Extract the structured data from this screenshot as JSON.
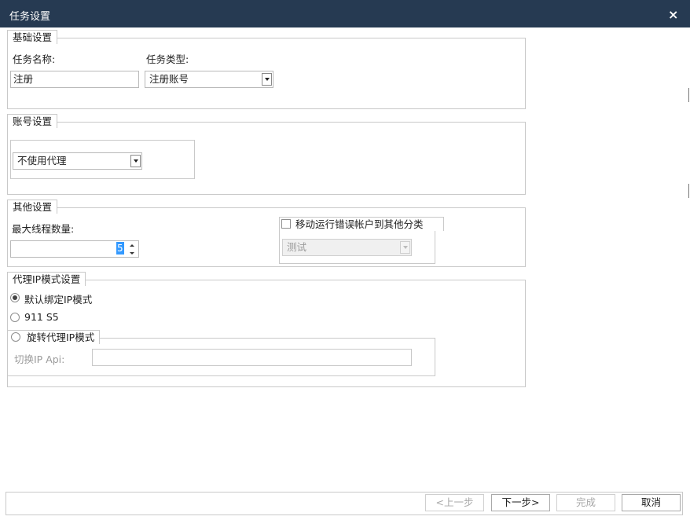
{
  "window": {
    "title": "任务设置",
    "close_icon": "×"
  },
  "basic": {
    "legend": "基础设置",
    "task_name_label": "任务名称:",
    "task_name_value": "注册",
    "task_type_label": "任务类型:",
    "task_type_value": "注册账号"
  },
  "account": {
    "legend": "账号设置",
    "proxy_value": "不使用代理"
  },
  "other": {
    "legend": "其他设置",
    "max_threads_label": "最大线程数量:",
    "max_threads_value": "5",
    "move_error_label": "移动运行错误帐户到其他分类",
    "move_error_checked": false,
    "category_value": "测试"
  },
  "proxy_ip": {
    "legend": "代理IP模式设置",
    "options": [
      {
        "label": "默认绑定IP模式",
        "selected": true
      },
      {
        "label": "911 S5",
        "selected": false
      },
      {
        "label": "旋转代理IP模式",
        "selected": false
      }
    ],
    "switch_api_label": "切换IP Api:",
    "switch_api_value": ""
  },
  "footer": {
    "prev": "<上一步",
    "next": "下一步>",
    "finish": "完成",
    "cancel": "取消"
  }
}
